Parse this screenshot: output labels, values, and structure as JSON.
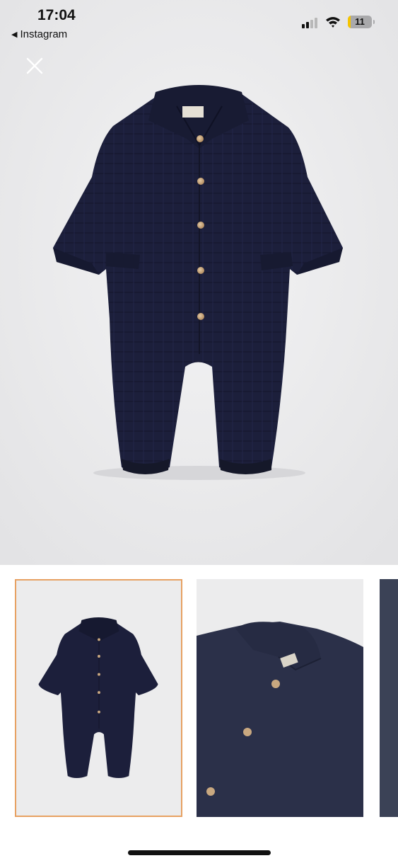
{
  "status_bar": {
    "time": "17:04",
    "back_label": "Instagram",
    "battery_level": "11",
    "battery_fraction": 0.11,
    "signal_bars_active": 2,
    "signal_bars_total": 4
  },
  "gallery": {
    "selected_index": 0,
    "thumbnail_count_visible": 3
  },
  "colors": {
    "garment_navy": "#1c1f3b",
    "background": "#ececed",
    "selection_border": "#e7a162",
    "button_wood": "#c9a880"
  },
  "icons": {
    "close": "close-icon",
    "back": "back-arrow-icon",
    "wifi": "wifi-icon",
    "battery": "battery-icon",
    "signal": "cellular-signal-icon"
  }
}
